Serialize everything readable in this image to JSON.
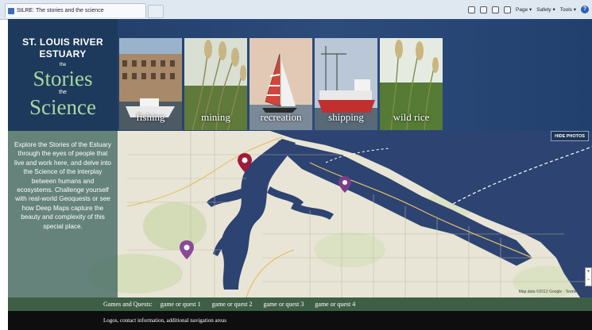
{
  "browser": {
    "tab_title": "StLRE: The stories and the science",
    "menu": [
      "Page ▾",
      "Safety ▾",
      "Tools ▾"
    ],
    "help": "?"
  },
  "header": {
    "line1": "ST. LOUIS RIVER",
    "line2": "ESTUARY",
    "the1": "the",
    "stories": "Stories",
    "the2": "the",
    "science": "Science"
  },
  "photos": [
    {
      "label": "fishing"
    },
    {
      "label": "mining"
    },
    {
      "label": "recreation"
    },
    {
      "label": "shipping"
    },
    {
      "label": "wild rice"
    }
  ],
  "hide_photos": "HIDE PHOTOS",
  "intro": "Explore the Stories of the Estuary through the eyes of people that live and work here, and delve into the Science of the interplay between humans and ecosystems. Challenge yourself with real-world Geoquests or see how Deep Maps capture the beauty and complexity of this special place.",
  "map": {
    "attribution": "Map data ©2012 Google · Terms of Use",
    "pins": 3
  },
  "games": {
    "label": "Games and Quests:",
    "items": [
      "game or quest 1",
      "game or quest 2",
      "game or quest 3",
      "game or quest 4"
    ]
  },
  "footer": "Logos, contact information, additional navigation areas",
  "colors": {
    "header_bg": "#1f3a63",
    "stories_green": "#a9d8a2",
    "games_bar": "#3e5f45",
    "footer_bg": "#0e0e0e",
    "pin": "#9d1b3c"
  }
}
